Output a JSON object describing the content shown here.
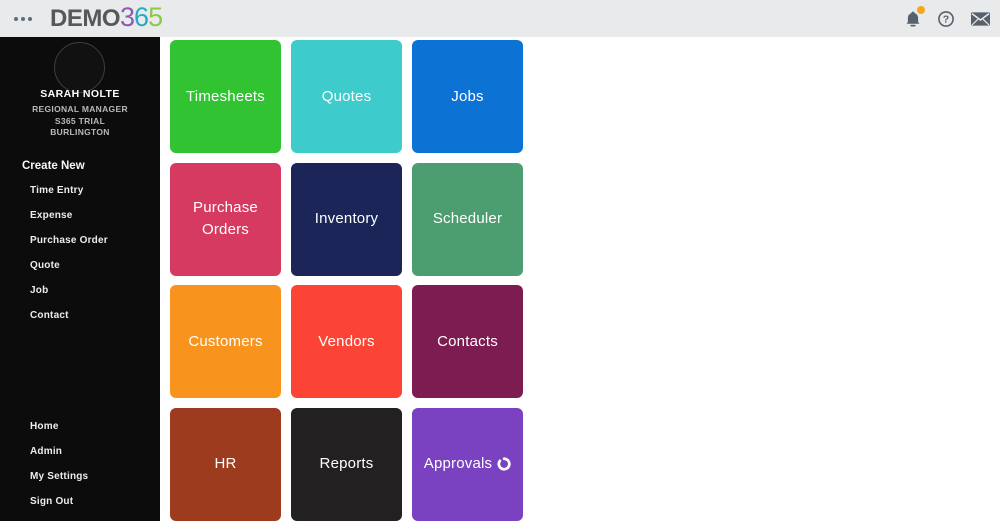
{
  "header": {
    "logo": {
      "word": "DEMO",
      "digit1": "3",
      "digit2": "6",
      "digit3": "5"
    },
    "help_glyph": "?",
    "colors": {
      "bar_bg": "#e9eaec",
      "logo_word": "#57585a",
      "logo_3": "#8f5bb1",
      "logo_6": "#25aac5",
      "logo_5": "#8fc844",
      "icon": "#56616c",
      "notification_dot": "#f3a71c"
    }
  },
  "sidebar": {
    "bg_color": "#0c0c0c",
    "profile": {
      "name": "SARAH NOLTE",
      "role": "REGIONAL MANAGER",
      "plan": "S365 TRIAL",
      "location": "BURLINGTON"
    },
    "create_new": {
      "header": "Create New",
      "items": [
        "Time Entry",
        "Expense",
        "Purchase Order",
        "Quote",
        "Job",
        "Contact"
      ]
    },
    "bottom_items": [
      "Home",
      "Admin",
      "My Settings",
      "Sign Out"
    ]
  },
  "tiles": [
    {
      "label": "Timesheets",
      "color": "#31c331"
    },
    {
      "label": "Quotes",
      "color": "#3ecbcb"
    },
    {
      "label": "Jobs",
      "color": "#0c73d5"
    },
    {
      "label": "Purchase Orders",
      "color": "#d73a60"
    },
    {
      "label": "Inventory",
      "color": "#1b2557"
    },
    {
      "label": "Scheduler",
      "color": "#4c9d6f"
    },
    {
      "label": "Customers",
      "color": "#f8941e"
    },
    {
      "label": "Vendors",
      "color": "#fb4436"
    },
    {
      "label": "Contacts",
      "color": "#7c1c51"
    },
    {
      "label": "HR",
      "color": "#9c3b1e"
    },
    {
      "label": "Reports",
      "color": "#232021"
    },
    {
      "label": "Approvals",
      "color": "#7a41c1",
      "icon": "spinner"
    }
  ]
}
